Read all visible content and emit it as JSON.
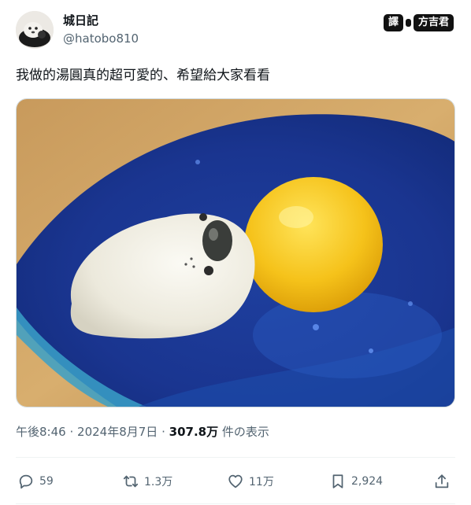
{
  "author": {
    "display_name": "城日記",
    "handle": "@hatobo810",
    "avatar_icon": "avatar-seal-icon"
  },
  "watermark": {
    "left_text": "譯",
    "right_text": "方吉君"
  },
  "tweet": {
    "text": "我做的湯圓真的超可愛的、希望給大家看看"
  },
  "media": {
    "description_icon": "photo-seal-tangyuan"
  },
  "meta": {
    "time": "午後8:46",
    "separator": "·",
    "date": "2024年8月7日",
    "views_count": "307.8万",
    "views_label": "件の表示"
  },
  "actions": {
    "reply_count": "59",
    "retweet_count": "1.3万",
    "like_count": "11万",
    "bookmark_count": "2,924"
  },
  "colors": {
    "text_primary": "#0f1419",
    "text_secondary": "#536471",
    "divider": "#eff3f4"
  }
}
